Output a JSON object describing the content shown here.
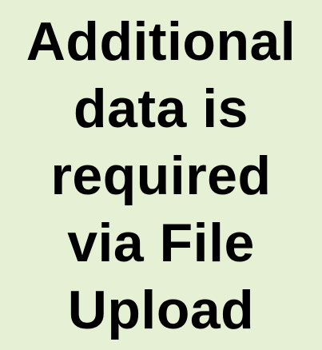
{
  "notice": {
    "lines": [
      "Additional",
      "data is",
      "required",
      "via File",
      "Upload"
    ],
    "background_color": "#e6f0d5",
    "text_color": "#000000"
  }
}
